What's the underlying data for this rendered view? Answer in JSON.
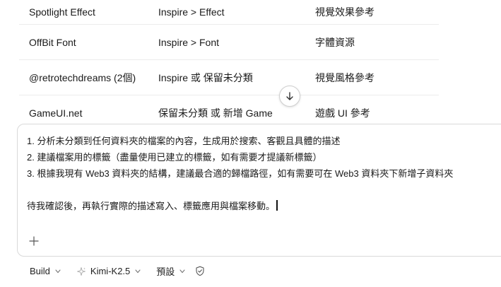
{
  "table": {
    "rows": [
      {
        "name": "Spotlight Effect",
        "path": "Inspire > Effect",
        "note": "視覺效果參考"
      },
      {
        "name": "OffBit Font",
        "path": "Inspire > Font",
        "note": "字體資源"
      },
      {
        "name": "@retrotechdreams (2個)",
        "path": "Inspire 或 保留未分類",
        "note": "視覺風格參考"
      },
      {
        "name": "GameUI.net",
        "path": "保留未分類 或 新增 Game",
        "note": "遊戲 UI 參考"
      }
    ]
  },
  "composer": {
    "lines": [
      "1. 分析未分類到任何資料夾的檔案的內容，生成用於搜索、客觀且具體的描述",
      "2. 建議檔案用的標籤（盡量使用已建立的標籤，如有需要才提議新標籤）",
      "3. 根據我現有 Web3 資料夾的結構，建議最合適的歸檔路徑，如有需要可在 Web3 資料夾下新增子資料夾",
      "待我確認後，再執行實際的描述寫入、標籤應用與檔案移動。"
    ]
  },
  "toolbar": {
    "mode": "Build",
    "model": "Kimi-K2.5",
    "preset": "預設"
  },
  "icons": {
    "scroll": "arrow-down-icon",
    "add": "plus-icon",
    "model": "sparkle-icon",
    "shield": "shield-check-icon"
  }
}
